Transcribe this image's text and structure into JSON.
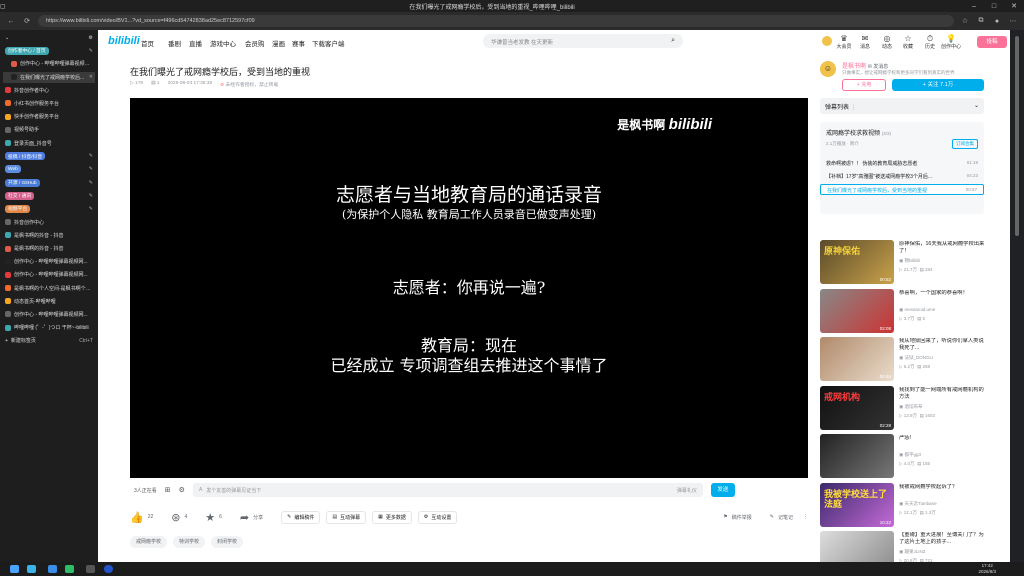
{
  "window": {
    "title": "在我们曝光了戒网瘾学校后，受到当地的重视_哔哩哔哩_bilibili"
  },
  "browser": {
    "url": "https://www.bilibili.com/video/BV1...?vd_source=f496cd54742838ad25ec8712597cf09"
  },
  "sidebar": {
    "items": [
      {
        "label": "创作者中心 / 首页",
        "kind": "group",
        "color": "#3fa7b0"
      },
      {
        "label": "创作中心 - 哔哩哔哩弹幕视频网...",
        "kind": "tab"
      },
      {
        "label": "在我们曝光了戒网瘾学校后...",
        "kind": "tab"
      },
      {
        "label": "抖音创作者中心",
        "kind": "tab"
      },
      {
        "label": "小红书创作服务平台",
        "kind": "tab"
      },
      {
        "label": "快手创作者服务平台",
        "kind": "tab"
      },
      {
        "label": "视频号助手",
        "kind": "tab"
      },
      {
        "label": "登录页面_抖音号",
        "kind": "tab"
      },
      {
        "label": "投稿 / 抖音/抖音",
        "kind": "group",
        "color": "#4f7ddf"
      },
      {
        "label": "Web",
        "kind": "group",
        "color": "#5b8de0"
      },
      {
        "label": "开源 / GitHub",
        "kind": "group",
        "color": "#4a7bd6"
      },
      {
        "label": "社交 / 通讯",
        "kind": "group",
        "color": "#d45f8a"
      },
      {
        "label": "视频平台",
        "kind": "group",
        "color": "#e0884a"
      },
      {
        "label": "抖音创作中心",
        "kind": "tab"
      },
      {
        "label": "是枫书啊的抖音 - 抖音",
        "kind": "tab"
      },
      {
        "label": "是枫书啊的抖音 - 抖音",
        "kind": "tab"
      },
      {
        "label": "创作中心 - 哔哩哔哩弹幕视频网...",
        "kind": "tab"
      },
      {
        "label": "创作中心 - 哔哩哔哩弹幕视频网...",
        "kind": "tab"
      },
      {
        "label": "是枫书啊的个人空间-是枫书啊个人...",
        "kind": "tab"
      },
      {
        "label": "动态首页-哔哩哔哩",
        "kind": "tab"
      },
      {
        "label": "创作中心 - 哔哩哔哩弹幕视频网...",
        "kind": "tab"
      },
      {
        "label": "哔哩哔哩 (゜-゜)つロ 干杯~-bilibili",
        "kind": "tab"
      },
      {
        "label": "新建标签页",
        "kind": "tab"
      }
    ],
    "new_tab": "新建标签页",
    "new_tab_shortcut": "Ctrl+T"
  },
  "header": {
    "logo": "bilibili",
    "nav": [
      "首页",
      "番剧",
      "直播",
      "游戏中心",
      "会员购",
      "漫画",
      "赛事",
      "下载客户端"
    ],
    "search_placeholder": "华谦曾当老发教 在天更新",
    "icons": [
      {
        "label": "大会员",
        "icon": "vip-icon"
      },
      {
        "label": "消息",
        "icon": "message-icon"
      },
      {
        "label": "动态",
        "icon": "dynamic-icon"
      },
      {
        "label": "收藏",
        "icon": "star-icon"
      },
      {
        "label": "历史",
        "icon": "history-icon"
      },
      {
        "label": "创作中心",
        "icon": "bulb-icon"
      }
    ],
    "upload": "投稿"
  },
  "video": {
    "title": "在我们曝光了戒网瘾学校后，受到当地的重视",
    "views": "178",
    "danmaku": "1",
    "date": "2026-08-03 17:36:38",
    "notice": "未经作者授权，禁止转载",
    "watermark_text": "是枫书啊",
    "watermark_logo": "bilibili",
    "subtitle_title": "志愿者与当地教育局的通话录音",
    "subtitle_note": "(为保护个人隐私 教育局工作人员录音已做变声处理)",
    "subtitle_q": "志愿者：你再说一遍?",
    "subtitle_a1": "教育局：现在",
    "subtitle_a2": "已经成立 专项调查组去推进这个事情了"
  },
  "danmaku_bar": {
    "viewers": "3人正在看",
    "placeholder": "发个友善的弹幕见证当下",
    "etiquette": "弹幕礼仪",
    "send": "发送"
  },
  "actions": {
    "like": "22",
    "coin": "4",
    "fav": "6",
    "share": "分享",
    "buttons": [
      "编辑稿件",
      "互动弹幕",
      "更多数据",
      "互动设置"
    ],
    "report": "稿件举报",
    "notes": "记笔记"
  },
  "tags": [
    "戒网瘾学校",
    "特训学校",
    "封闭学校"
  ],
  "uploader": {
    "name": "是枫书啊",
    "msg": "发消息",
    "desc": "只做事实，想让戒网瘾学校和更多同学们看到真实的世界",
    "charge": "充电",
    "follow": "+ 关注 7.1万"
  },
  "danmaku_list": {
    "label": "弹幕列表"
  },
  "collection": {
    "title": "戒网瘾学校求救视频",
    "count": "(3/3)",
    "stats": "2.1万播放 · 简介",
    "subscribe": "订阅合集",
    "items": [
      {
        "title": "救命啊被虐？！ 伪装的教育局威胁志愿者",
        "time": "01:19"
      },
      {
        "title": "【补档】17岁\"高雅图\"被送戒网瘾学校3个月后...",
        "time": "04:23"
      },
      {
        "title": "在我们曝光了戒网瘾学校后，受到当地的重视",
        "time": "00:57"
      }
    ]
  },
  "recommend": [
    {
      "title": "原神保佑，16天我从戒网瘾学校出来了！",
      "author": "锦bilibili",
      "views": "21.7万",
      "comments": "284",
      "duration": "00:52",
      "thumb_text": "原神保佑"
    },
    {
      "title": "恭喜啊，一个国家的恭喜啊！",
      "author": "messaroid.ume",
      "views": "3.7万",
      "comments": "5",
      "duration": "02:08",
      "thumb_text": ""
    },
    {
      "title": "我从地狱回来了，听说你们拿人类说我死了...",
      "author": "法狱_DONGLI",
      "views": "5.2万",
      "comments": "258",
      "duration": "00:40",
      "thumb_text": ""
    },
    {
      "title": "我找到了能一网端所有戒网瘾机构的方法",
      "author": "酒馆布布",
      "views": "13.9万",
      "comments": "1603",
      "duration": "02:28",
      "thumb_text": "戒网机构"
    },
    {
      "title": "严惩!",
      "author": "都平gg3",
      "views": "4.0万",
      "comments": "155",
      "duration": "",
      "thumb_text": ""
    },
    {
      "title": "我被戒网瘾学校起诉了？",
      "author": "天天恋Tianbane",
      "views": "12.1万",
      "comments": "1.3万",
      "duration": "10:22",
      "thumb_text": "我被学校送上了法庭"
    },
    {
      "title": "【重磅】重大进展！至博关门了？为了这片土地上的孩子...",
      "author": "趣果JLINZ",
      "views": "20.8万",
      "comments": "721",
      "duration": "01:34",
      "thumb_text": ""
    }
  ],
  "taskbar": {
    "time": "17:42",
    "date": "2026/8/3"
  }
}
